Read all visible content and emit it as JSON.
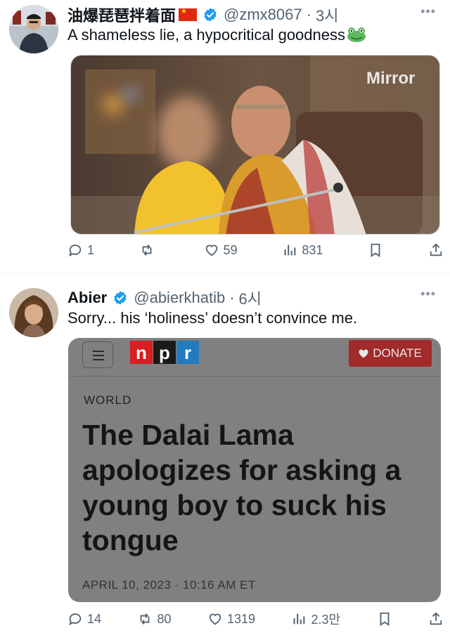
{
  "tweets": [
    {
      "display_name": "油爆琵琶拌着面",
      "handle": "@zmx8067",
      "time": "3시",
      "text": "A shameless lie, a hypocritical goodness",
      "media": {
        "watermark": "Mirror"
      },
      "stats": {
        "replies": "1",
        "reposts": "",
        "likes": "59",
        "views": "831"
      }
    },
    {
      "display_name": "Abier",
      "handle": "@abierkhatib",
      "time": "6시",
      "text": "Sorry... his ‘holiness’ doesn’t convince me.",
      "card": {
        "logo_letters": [
          "n",
          "p",
          "r"
        ],
        "donate_label": "DONATE",
        "section": "WORLD",
        "headline": "The Dalai Lama apologizes for asking a young boy to suck his tongue",
        "date": "APRIL 10, 2023 · 10:16 AM ET"
      },
      "stats": {
        "replies": "14",
        "reposts": "80",
        "likes": "1319",
        "views": "2.3만"
      }
    }
  ],
  "separator": "·",
  "more_glyph": "•••",
  "colors": {
    "verified": "#1d9bf0",
    "npr_red": "#d62021",
    "npr_black": "#1a1a1a",
    "npr_blue": "#237bbd",
    "donate_bg": "#a12a2a"
  }
}
